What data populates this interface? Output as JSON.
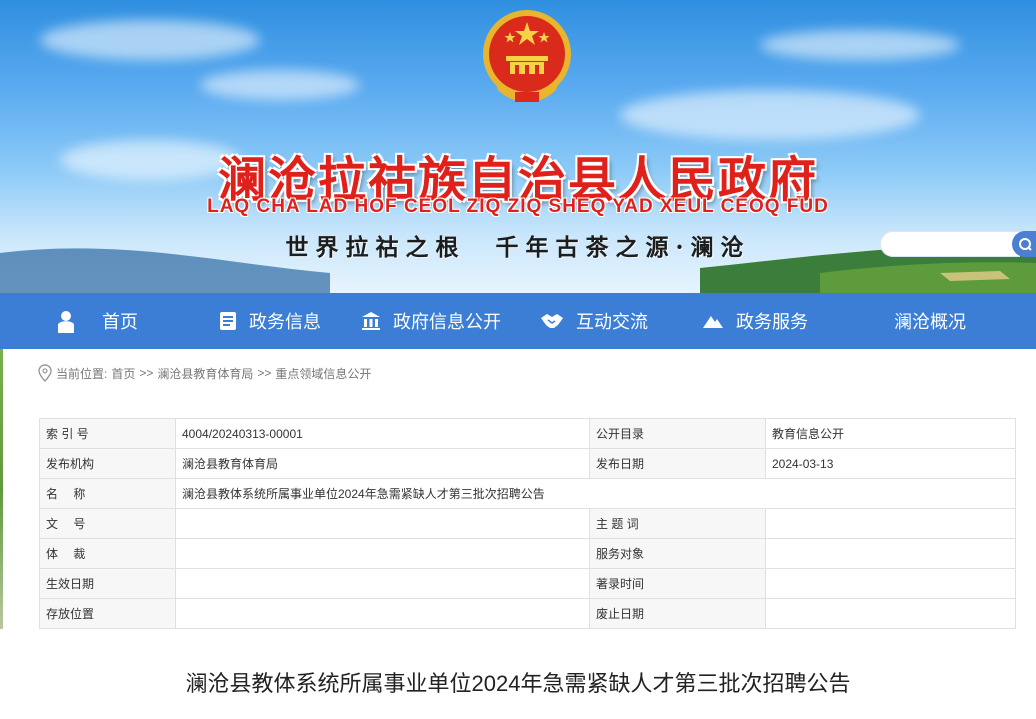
{
  "header": {
    "title": "澜沧拉祜族自治县人民政府",
    "subtitle": "LAQ CHA LAD HOF CEOL ZIQ ZIQ SHEQ YAD XEUL CEOQ FUD",
    "slogan": "世界拉祜之根　千年古茶之源·澜沧",
    "emblem_icon": "national-emblem-icon",
    "search": {
      "placeholder": "",
      "button_icon": "search-icon"
    }
  },
  "nav": {
    "items": [
      {
        "label": "首页",
        "icon": "home-icon"
      },
      {
        "label": "政务信息",
        "icon": "document-icon"
      },
      {
        "label": "政府信息公开",
        "icon": "building-icon"
      },
      {
        "label": "互动交流",
        "icon": "handshake-icon"
      },
      {
        "label": "政务服务",
        "icon": "mountain-icon"
      },
      {
        "label": "澜沧概况",
        "icon": ""
      }
    ]
  },
  "breadcrumb": {
    "icon": "location-pin-icon",
    "prefix": "当前位置:",
    "items": [
      "首页",
      "澜沧县教育体育局",
      "重点领域信息公开"
    ],
    "separator": ">>"
  },
  "meta": {
    "rows": [
      [
        "索 引 号",
        "4004/20240313-00001",
        "公开目录",
        "教育信息公开"
      ],
      [
        "发布机构",
        "澜沧县教育体育局",
        "发布日期",
        "2024-03-13"
      ],
      [
        "名　 称",
        "澜沧县教体系统所属事业单位2024年急需紧缺人才第三批次招聘公告"
      ],
      [
        "文　 号",
        "",
        "主 题 词",
        ""
      ],
      [
        "体　 裁",
        "",
        "服务对象",
        ""
      ],
      [
        "生效日期",
        "",
        "著录时间",
        ""
      ],
      [
        "存放位置",
        "",
        "废止日期",
        ""
      ]
    ]
  },
  "article": {
    "title": "澜沧县教体系统所属事业单位2024年急需紧缺人才第三批次招聘公告"
  },
  "colors": {
    "nav_bg": "#3c7ed6",
    "title_red": "#e0201a",
    "label_bg": "#f7f7f7",
    "border": "#e0e0e0"
  }
}
